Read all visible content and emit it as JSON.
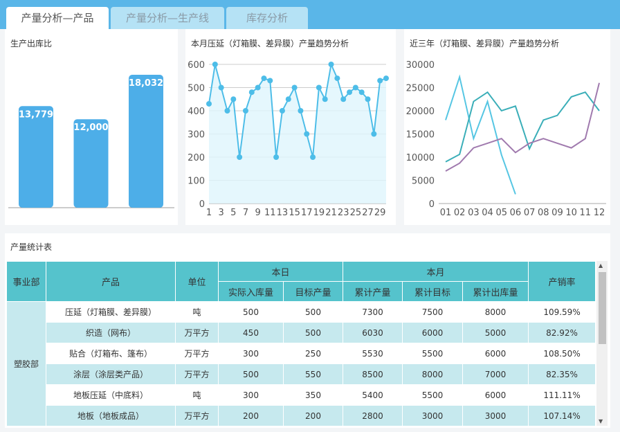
{
  "tabs": [
    {
      "label": "产量分析—产品"
    },
    {
      "label": "产量分析—生产线"
    },
    {
      "label": "库存分析"
    }
  ],
  "panels": {
    "bar_title": "生产出库比",
    "line_title": "本月压延（灯箱膜、差异膜）产量趋势分析",
    "multi_title": "近三年（灯箱膜、差异膜）产量趋势分析",
    "table_title": "产量统计表"
  },
  "chart_data": [
    {
      "type": "bar",
      "values": [
        13779,
        12000,
        18032
      ],
      "labels": [
        "13,779",
        "12,000",
        "18,032"
      ],
      "color": "#4daee8"
    },
    {
      "type": "area",
      "x": [
        1,
        2,
        3,
        4,
        5,
        6,
        7,
        8,
        9,
        10,
        11,
        12,
        13,
        14,
        15,
        16,
        17,
        18,
        19,
        20,
        21,
        22,
        23,
        24,
        25,
        26,
        27,
        28,
        29,
        30
      ],
      "xticks": [
        "1",
        "3",
        "5",
        "7",
        "9",
        "11",
        "13",
        "15",
        "17",
        "19",
        "21",
        "23",
        "25",
        "27",
        "29"
      ],
      "values": [
        430,
        600,
        500,
        400,
        450,
        200,
        400,
        480,
        500,
        540,
        530,
        200,
        400,
        450,
        500,
        400,
        300,
        200,
        500,
        450,
        600,
        540,
        450,
        480,
        500,
        480,
        450,
        300,
        530,
        540
      ],
      "ylim": [
        0,
        600
      ],
      "yticks": [
        "0",
        "100",
        "200",
        "300",
        "400",
        "500",
        "600"
      ],
      "grid": true,
      "color": "#4dbde8"
    },
    {
      "type": "line",
      "categories": [
        "01",
        "02",
        "03",
        "04",
        "05",
        "06",
        "07",
        "08",
        "09",
        "10",
        "11",
        "12"
      ],
      "ylim": [
        0,
        30000
      ],
      "yticks": [
        "0",
        "5000",
        "10000",
        "15000",
        "20000",
        "25000",
        "30000"
      ],
      "series": [
        {
          "values": [
            18000,
            27300,
            14000,
            22000,
            10500,
            2000
          ],
          "color": "#56c6e3"
        },
        {
          "values": [
            9000,
            10600,
            22000,
            24000,
            20000,
            21000,
            11800,
            18000,
            19000,
            23000,
            24000,
            20000
          ],
          "color": "#3aaeb8"
        },
        {
          "values": [
            7000,
            8700,
            12000,
            13000,
            14000,
            11000,
            13000,
            14000,
            13000,
            12000,
            14000,
            26000
          ],
          "color": "#a07aae"
        }
      ]
    }
  ],
  "table": {
    "h": {
      "dept": "事业部",
      "product": "产品",
      "unit": "单位",
      "day": "本日",
      "month": "本月",
      "rate": "产销率",
      "actual": "实际入库量",
      "target": "目标产量",
      "cum": "累计产量",
      "cumtarget": "累计目标",
      "cumout": "累计出库量"
    },
    "dept": "塑胶部",
    "rows": [
      [
        "压延（灯箱膜、差异膜）",
        "吨",
        "500",
        "500",
        "7300",
        "7500",
        "8000",
        "109.59%"
      ],
      [
        "织造（网布）",
        "万平方",
        "450",
        "500",
        "6030",
        "6000",
        "5000",
        "82.92%"
      ],
      [
        "贴合（灯箱布、篷布）",
        "万平方",
        "300",
        "250",
        "5530",
        "5500",
        "6000",
        "108.50%"
      ],
      [
        "涂层（涂层类产品）",
        "万平方",
        "500",
        "550",
        "8500",
        "8000",
        "7000",
        "82.35%"
      ],
      [
        "地板压延（中底料）",
        "吨",
        "300",
        "350",
        "5400",
        "5500",
        "6000",
        "111.11%"
      ],
      [
        "地板（地板成品）",
        "万平方",
        "200",
        "200",
        "2800",
        "3000",
        "3000",
        "107.14%"
      ]
    ]
  }
}
